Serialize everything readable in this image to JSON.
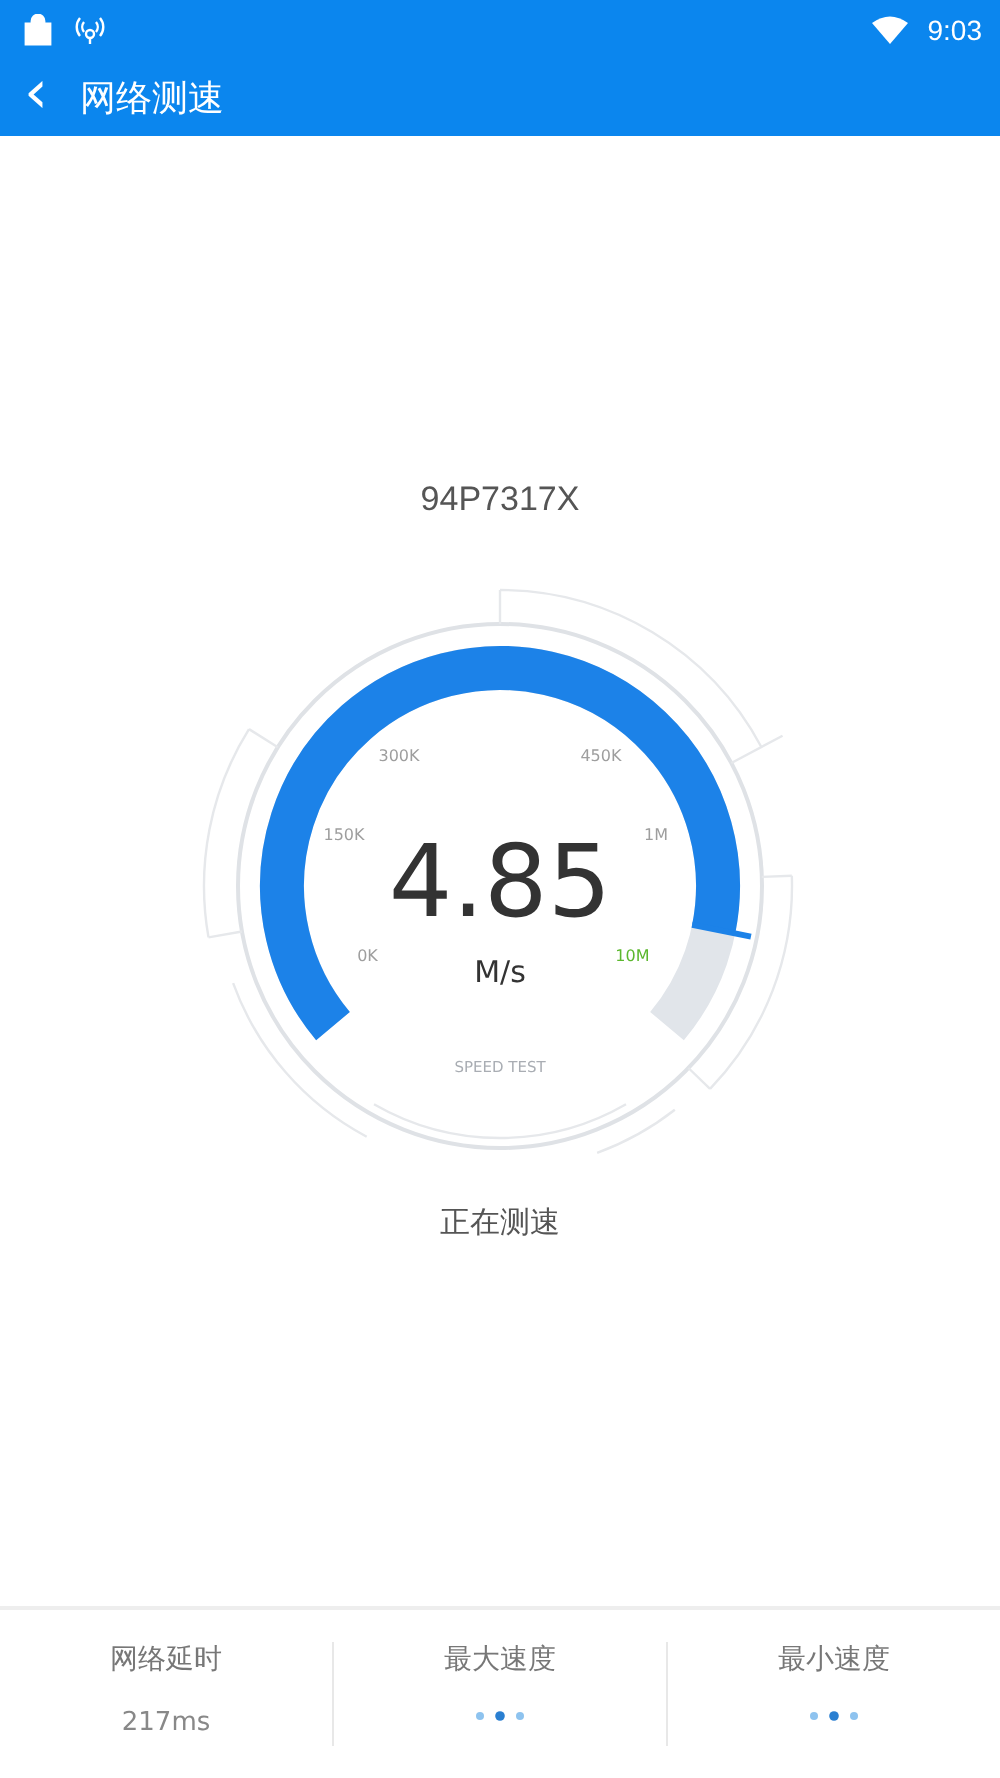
{
  "status_bar": {
    "time": "9:03"
  },
  "header": {
    "back_icon": "‹",
    "title": "网络测速"
  },
  "device": "94P7317X",
  "gauge": {
    "value": "4.85",
    "unit": "M/s",
    "caption": "SPEED TEST",
    "scale": [
      {
        "label": "0K",
        "color": "#9e9e9e"
      },
      {
        "label": "150K",
        "color": "#9e9e9e"
      },
      {
        "label": "300K",
        "color": "#9e9e9e"
      },
      {
        "label": "450K",
        "color": "#9e9e9e"
      },
      {
        "label": "1M",
        "color": "#9e9e9e"
      },
      {
        "label": "10M",
        "color": "#5cb82e"
      }
    ]
  },
  "status": "正在测速",
  "stats": [
    {
      "label": "网络延时",
      "kind": "value",
      "value": "217ms"
    },
    {
      "label": "最大速度",
      "kind": "loading"
    },
    {
      "label": "最小速度",
      "kind": "loading"
    }
  ]
}
